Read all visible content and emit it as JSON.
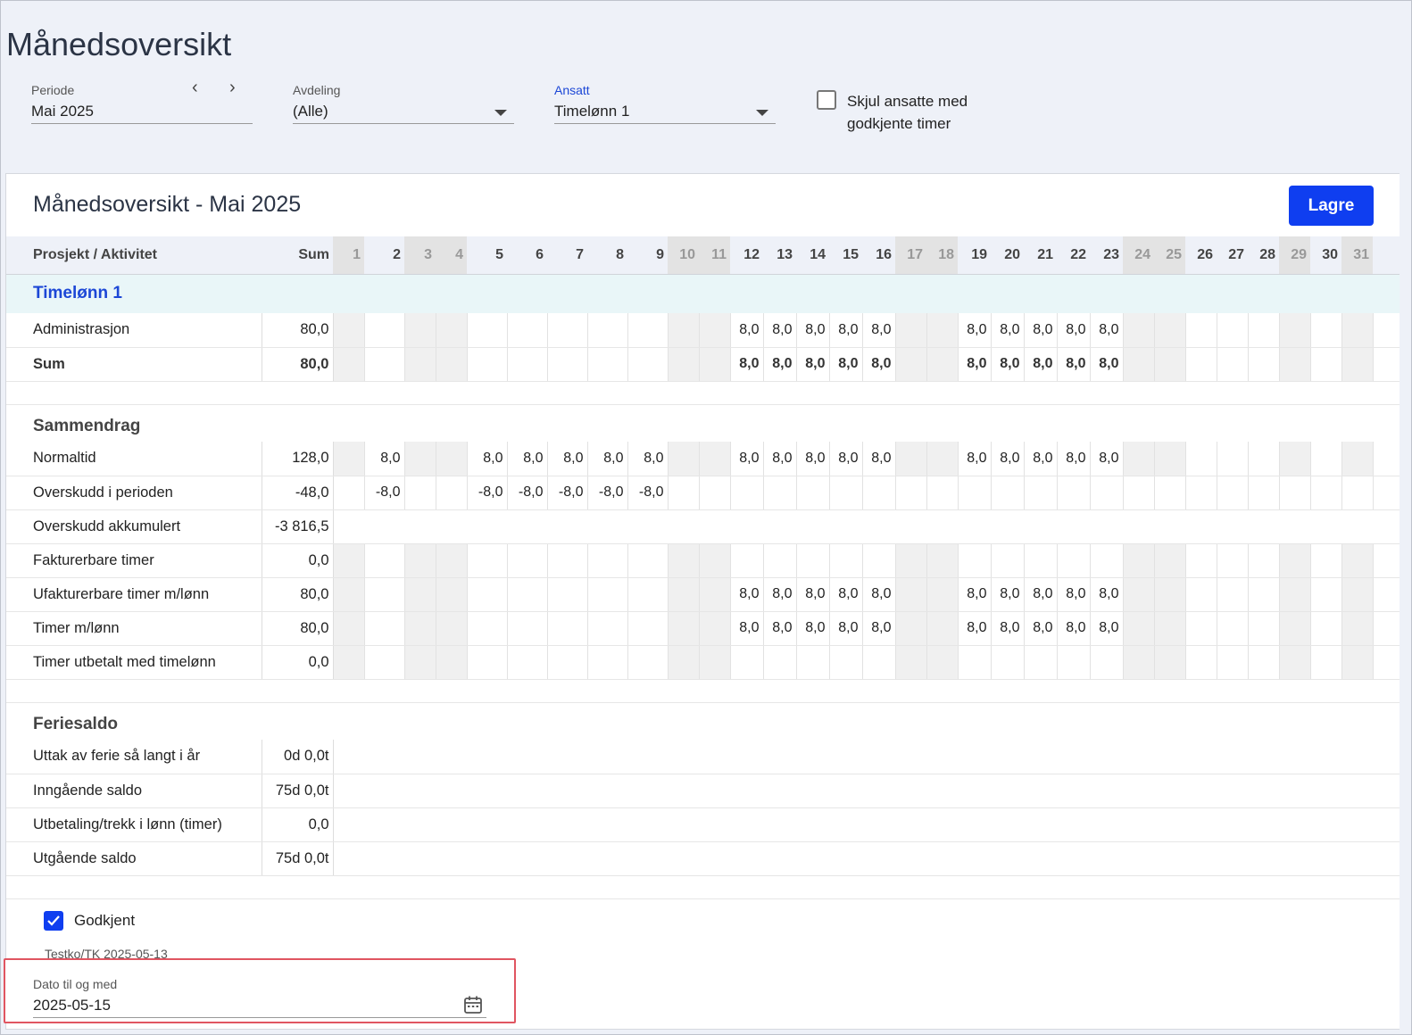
{
  "page_title": "Månedsoversikt",
  "filters": {
    "periode": {
      "label": "Periode",
      "value": "Mai 2025"
    },
    "avdeling": {
      "label": "Avdeling",
      "value": "(Alle)"
    },
    "ansatt": {
      "label": "Ansatt",
      "value": "Timelønn 1"
    },
    "hide_approved": {
      "label": "Skjul ansatte med godkjente timer",
      "checked": false
    }
  },
  "panel": {
    "title": "Månedsoversikt - Mai 2025",
    "save_label": "Lagre"
  },
  "table": {
    "col_project": "Prosjekt / Aktivitet",
    "col_sum": "Sum",
    "days": [
      "1",
      "2",
      "3",
      "4",
      "5",
      "6",
      "7",
      "8",
      "9",
      "10",
      "11",
      "12",
      "13",
      "14",
      "15",
      "16",
      "17",
      "18",
      "19",
      "20",
      "21",
      "22",
      "23",
      "24",
      "25",
      "26",
      "27",
      "28",
      "29",
      "30",
      "31"
    ],
    "weekend_days": [
      1,
      3,
      4,
      10,
      11,
      17,
      18,
      24,
      25,
      29,
      31
    ],
    "group_label": "Timelønn 1",
    "project_rows": [
      {
        "label": "Administrasjon",
        "sum": "80,0",
        "values": {
          "12": "8,0",
          "13": "8,0",
          "14": "8,0",
          "15": "8,0",
          "16": "8,0",
          "19": "8,0",
          "20": "8,0",
          "21": "8,0",
          "22": "8,0",
          "23": "8,0"
        },
        "bold": false
      },
      {
        "label": "Sum",
        "sum": "80,0",
        "values": {
          "12": "8,0",
          "13": "8,0",
          "14": "8,0",
          "15": "8,0",
          "16": "8,0",
          "19": "8,0",
          "20": "8,0",
          "21": "8,0",
          "22": "8,0",
          "23": "8,0"
        },
        "bold": true
      }
    ],
    "summary_title": "Sammendrag",
    "summary_rows": [
      {
        "label": "Normaltid",
        "sum": "128,0",
        "values": {
          "2": "8,0",
          "5": "8,0",
          "6": "8,0",
          "7": "8,0",
          "8": "8,0",
          "9": "8,0",
          "12": "8,0",
          "13": "8,0",
          "14": "8,0",
          "15": "8,0",
          "16": "8,0",
          "19": "8,0",
          "20": "8,0",
          "21": "8,0",
          "22": "8,0",
          "23": "8,0"
        }
      },
      {
        "label": "Overskudd i perioden",
        "sum": "-48,0",
        "values": {
          "2": "-8,0",
          "5": "-8,0",
          "6": "-8,0",
          "7": "-8,0",
          "8": "-8,0",
          "9": "-8,0"
        },
        "no_weekend": true
      },
      {
        "label": "Overskudd akkumulert",
        "sum": "-3 816,5",
        "total_only": true
      },
      {
        "label": "Fakturerbare timer",
        "sum": "0,0",
        "values": {}
      },
      {
        "label": "Ufakturerbare timer m/lønn",
        "sum": "80,0",
        "values": {
          "12": "8,0",
          "13": "8,0",
          "14": "8,0",
          "15": "8,0",
          "16": "8,0",
          "19": "8,0",
          "20": "8,0",
          "21": "8,0",
          "22": "8,0",
          "23": "8,0"
        }
      },
      {
        "label": "Timer m/lønn",
        "sum": "80,0",
        "values": {
          "12": "8,0",
          "13": "8,0",
          "14": "8,0",
          "15": "8,0",
          "16": "8,0",
          "19": "8,0",
          "20": "8,0",
          "21": "8,0",
          "22": "8,0",
          "23": "8,0"
        }
      },
      {
        "label": "Timer utbetalt med timelønn",
        "sum": "0,0",
        "values": {}
      }
    ],
    "vacation_title": "Feriesaldo",
    "vacation_rows": [
      {
        "label": "Uttak av ferie så langt i år",
        "sum": "0d 0,0t"
      },
      {
        "label": "Inngående saldo",
        "sum": "75d 0,0t"
      },
      {
        "label": "Utbetaling/trekk i lønn (timer)",
        "sum": "0,0"
      },
      {
        "label": "Utgående saldo",
        "sum": "75d 0,0t"
      }
    ]
  },
  "approval": {
    "label": "Godkjent",
    "checked": true,
    "approved_by": "Testko/TK 2025-05-13"
  },
  "date_field": {
    "label": "Dato til og med",
    "value": "2025-05-15"
  },
  "colors": {
    "accent": "#0f3ef0",
    "group_bg": "#e9f6f8",
    "weekend_bg": "#f0f0f0",
    "highlight_border": "#e05561"
  },
  "icons": [
    "chevron-left-icon",
    "chevron-right-icon",
    "caret-down-icon",
    "checkmark-icon",
    "calendar-icon"
  ]
}
